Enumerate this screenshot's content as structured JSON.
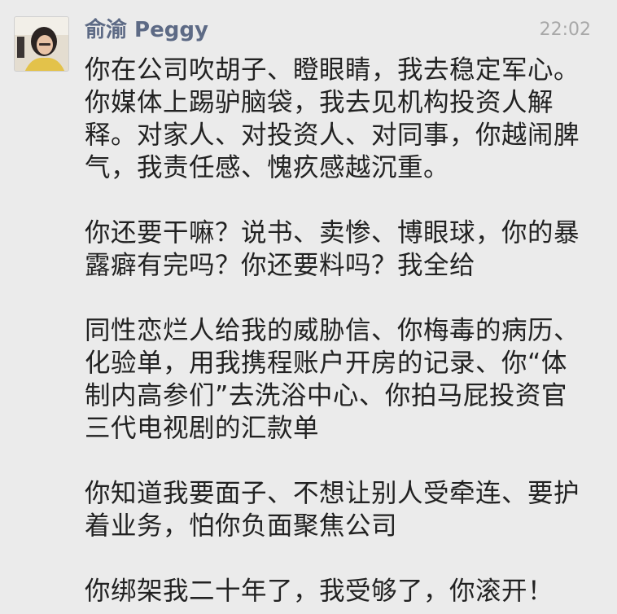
{
  "header": {
    "sender_name": "俞渝 Peggy",
    "time": "22:02"
  },
  "avatar": {
    "icon": "user-avatar-photo"
  },
  "message": {
    "paragraphs": [
      [
        "你在公司吹胡子、瞪眼睛，我去稳定军心。",
        "你媒体上踢驴脑袋，我去见机构投资人解",
        "释。对家人、对投资人、对同事，你越闹脾",
        "气，我责任感、愧疚感越沉重。"
      ],
      [
        "你还要干嘛？说书、卖惨、博眼球，你的暴",
        "露癖有完吗？你还要料吗？我全给"
      ],
      [
        "同性恋烂人给我的威胁信、你梅毒的病历、",
        "化验单，用我携程账户开房的记录、你“体",
        "制内高参们”去洗浴中心、你拍马屁投资官",
        "三代电视剧的汇款单"
      ],
      [
        "你知道我要面子、不想让别人受牵连、要护",
        "着业务，怕你负面聚焦公司"
      ],
      [
        "你绑架我二十年了，我受够了，你滚开！"
      ]
    ]
  }
}
